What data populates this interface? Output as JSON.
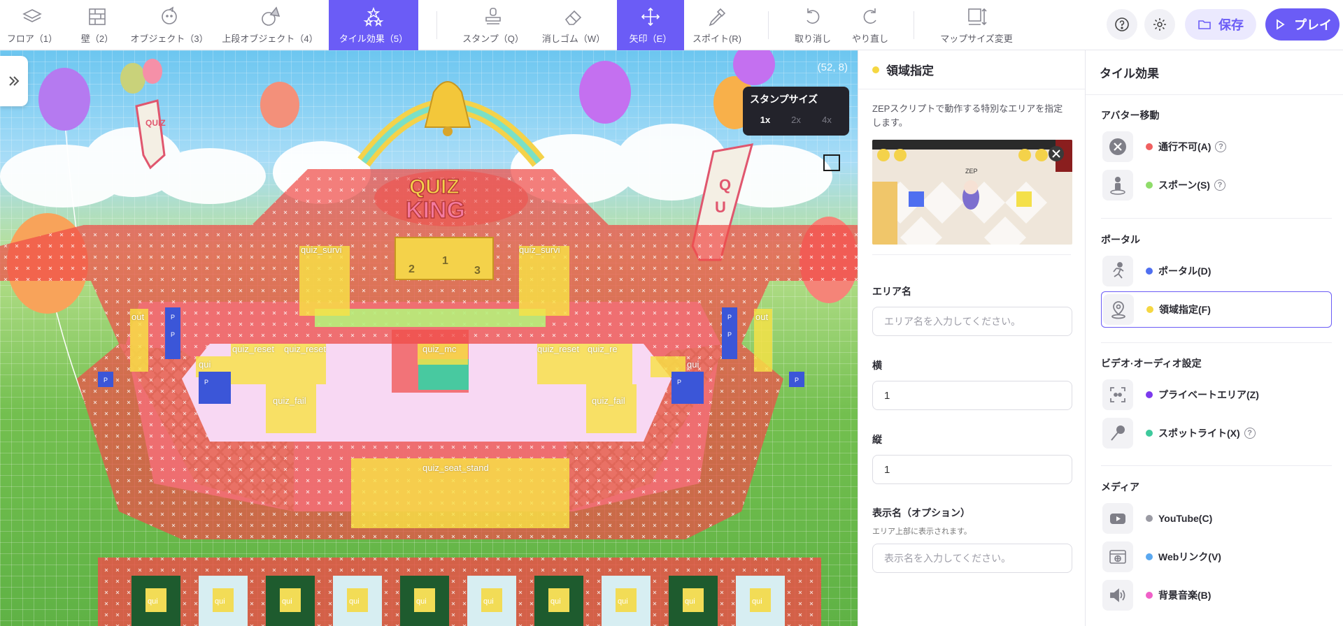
{
  "toolbar": {
    "tools": [
      {
        "label": "フロア（1）",
        "icon": "layers-icon"
      },
      {
        "label": "壁（2）",
        "icon": "wall-icon"
      },
      {
        "label": "オブジェクト（3）",
        "icon": "object-icon"
      },
      {
        "label": "上段オブジェクト（4）",
        "icon": "top-object-icon"
      },
      {
        "label": "タイル効果（5）",
        "icon": "tile-effect-icon",
        "active": true
      },
      {
        "label": "スタンプ（Q）",
        "icon": "stamp-icon"
      },
      {
        "label": "消しゴム（W）",
        "icon": "eraser-icon"
      },
      {
        "label": "矢印（E）",
        "icon": "move-arrow-icon",
        "active": true
      },
      {
        "label": "スポイト(R)",
        "icon": "eyedropper-icon"
      },
      {
        "label": "取り消し",
        "icon": "undo-icon"
      },
      {
        "label": "やり直し",
        "icon": "redo-icon"
      },
      {
        "label": "マップサイズ変更",
        "icon": "resize-map-icon"
      }
    ],
    "save_label": "保存",
    "play_label": "プレイ",
    "accent": "#6b5cf6"
  },
  "map": {
    "coords": "(52, 8)",
    "stamp_popup": {
      "title": "スタンプサイズ",
      "options": [
        "1x",
        "2x",
        "4x"
      ],
      "selected": "1x"
    },
    "labels": {
      "survival_left": "quiz_survi",
      "survival_right": "quiz_survi",
      "out_left": "out",
      "out_right": "out",
      "reset_1": "quiz_reset",
      "reset_2": "quiz_reset",
      "reset_3": "quiz_reset",
      "reset_4": "quiz_re",
      "mc": "quiz_mc",
      "fail_left": "quiz_fail",
      "fail_right": "quiz_fail",
      "qui_left": "qui",
      "qui_right": "qui",
      "seat_stand": "quiz_seat_stand",
      "quiz_banner": "QUIZ",
      "king_top": "QUIZ",
      "king_bottom": "KING",
      "podium_1": "1",
      "podium_2": "2",
      "podium_3": "3",
      "booth": "qui",
      "portal_tile": "P"
    }
  },
  "area_panel": {
    "title": "領域指定",
    "dot_color": "#f5d742",
    "description": "ZEPスクリプトで動作する特別なエリアを指定します。",
    "preview_tag": "ZEP",
    "fields": {
      "name_label": "エリア名",
      "name_placeholder": "エリア名を入力してください。",
      "width_label": "横",
      "width_value": "1",
      "height_label": "縦",
      "height_value": "1",
      "display_label": "表示名（オプション）",
      "display_sub": "エリア上部に表示されます。",
      "display_placeholder": "表示名を入力してください。"
    }
  },
  "fx_panel": {
    "title": "タイル効果",
    "sections": {
      "avatar": "アバター移動",
      "portal": "ポータル",
      "av": "ビデオ·オーディオ設定",
      "media": "メディア"
    },
    "items": {
      "blocked": {
        "label": "通行不可(A)",
        "color": "#f06060"
      },
      "spawn": {
        "label": "スポーン(S)",
        "color": "#8fdc6a"
      },
      "portal": {
        "label": "ポータル(D)",
        "color": "#4f6ff0"
      },
      "area": {
        "label": "領域指定(F)",
        "color": "#f5d742"
      },
      "private": {
        "label": "プライベートエリア(Z)",
        "color": "#7c3aed"
      },
      "spotlight": {
        "label": "スポットライト(X)",
        "color": "#3ec99c"
      },
      "youtube": {
        "label": "YouTube(C)",
        "color": "#9a9aa3"
      },
      "weblink": {
        "label": "Webリンク(V)",
        "color": "#5aa8f0"
      },
      "bgm": {
        "label": "背景音楽(B)",
        "color": "#f060c8"
      }
    },
    "help_glyph": "?"
  }
}
